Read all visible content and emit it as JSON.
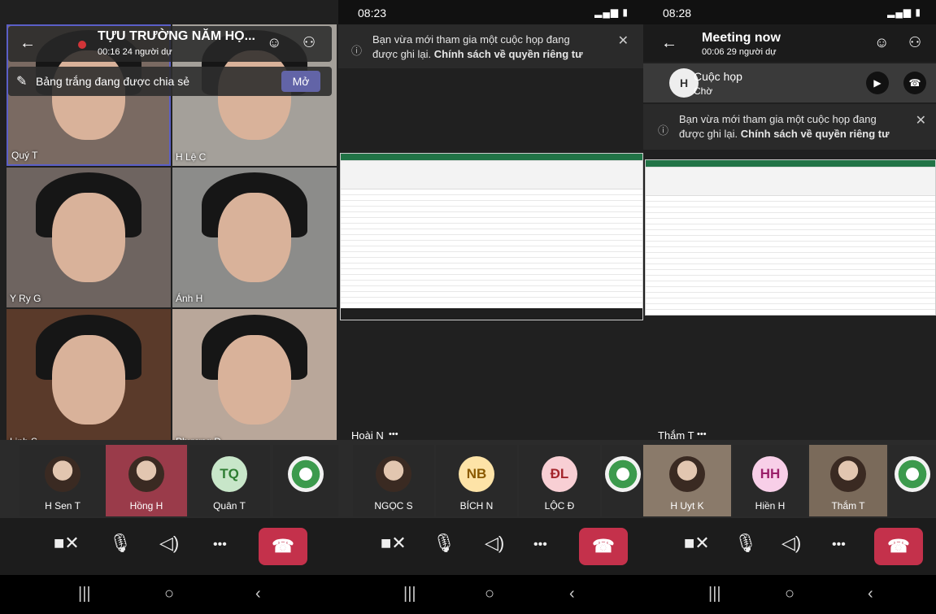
{
  "colors": {
    "accent": "#6264a7",
    "hangup": "#c4314b"
  },
  "phone1": {
    "meeting_title": "TỰU TRƯỜNG NĂM HỌ...",
    "meeting_meta": "00:16 24 người dự",
    "whiteboard_banner": "Bảng trắng đang được chia sẻ",
    "open_label": "Mở",
    "video_tiles": [
      "Quý T",
      "H Lệ C",
      "Y Ry G",
      "Ánh H",
      "Linh S",
      "Phương Đ"
    ],
    "strip": [
      "H Sen T",
      "Hồng H",
      "Quân T"
    ],
    "quan_initials": "TQ"
  },
  "phone2": {
    "time": "08:23",
    "notice_line1": "Bạn vừa mới tham gia một cuộc họp đang",
    "notice_line2_plain": "được ghi lại. ",
    "notice_line2_bold": "Chính sách về quyền riêng tư",
    "presenter": "Hoài N",
    "strip": [
      {
        "name": "NGỌC S",
        "initials": ""
      },
      {
        "name": "BÍCH N",
        "initials": "NB"
      },
      {
        "name": "LỘC Đ",
        "initials": "ĐL"
      }
    ]
  },
  "phone3": {
    "time": "08:28",
    "meeting_title": "Meeting now",
    "meeting_meta": "00:06 29 người dự",
    "held_title": "Cuộc họp",
    "held_status": "Chờ",
    "held_initial": "H",
    "notice_line1": "Bạn vừa mới tham gia một cuộc họp đang",
    "notice_line2_plain": "được ghi lại. ",
    "notice_line2_bold": "Chính sách về quyền riêng tư",
    "presenter": "Thắm T",
    "strip": [
      {
        "name": "H Uyt K",
        "initials": ""
      },
      {
        "name": "Hiền H",
        "initials": "HH"
      },
      {
        "name": "Thắm T",
        "initials": ""
      }
    ]
  },
  "more_glyph": "•••"
}
